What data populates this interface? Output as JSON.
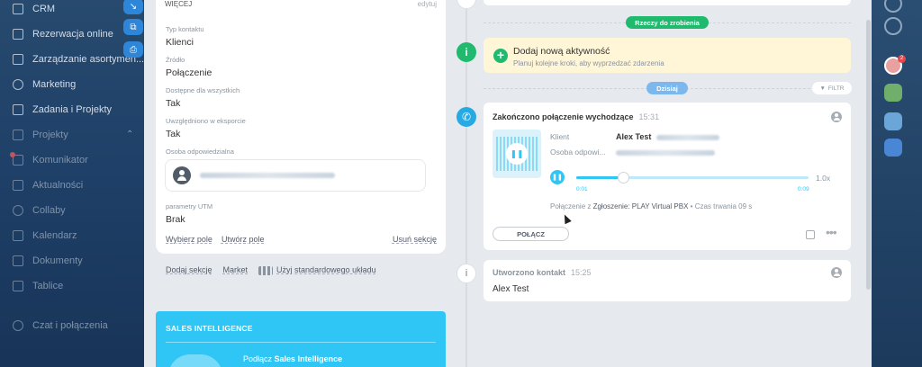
{
  "sidebar": {
    "items": [
      {
        "label": "CRM",
        "dim": false
      },
      {
        "label": "Rezerwacja online",
        "dim": false
      },
      {
        "label": "Zarządzanie asortymen...",
        "dim": false
      },
      {
        "label": "Marketing",
        "dim": false
      },
      {
        "label": "Zadania i Projekty",
        "dim": false
      },
      {
        "label": "Projekty",
        "dim": true
      },
      {
        "label": "Komunikator",
        "dim": true
      },
      {
        "label": "Aktualności",
        "dim": true
      },
      {
        "label": "Collaby",
        "dim": true
      },
      {
        "label": "Kalendarz",
        "dim": true
      },
      {
        "label": "Dokumenty",
        "dim": true
      },
      {
        "label": "Tablice",
        "dim": true
      },
      {
        "label": "Czat i połączenia",
        "dim": true
      }
    ]
  },
  "details": {
    "more_label": "WIĘCEJ",
    "edit_label": "edytuj",
    "contact_type_label": "Typ kontaktu",
    "contact_type_value": "Klienci",
    "source_label": "Źródło",
    "source_value": "Połączenie",
    "available_label": "Dostępne dla wszystkich",
    "available_value": "Tak",
    "export_label": "Uwzględniono w eksporcie",
    "export_value": "Tak",
    "responsible_label": "Osoba odpowiedzialna",
    "utm_label": "parametry UTM",
    "utm_value": "Brak",
    "select_field": "Wybierz pole",
    "create_field": "Utwórz pole",
    "delete_section": "Usuń sekcję"
  },
  "bottom_links": {
    "add_section": "Dodaj sekcję",
    "market": "Market",
    "default_layout": "Użyj standardowego układu"
  },
  "sales_intelligence": {
    "title": "SALES INTELLIGENCE",
    "connect_prefix": "Podłącz",
    "connect_name": "Sales Intelligence"
  },
  "timeline": {
    "todo_pill": "Rzeczy do zrobienia",
    "today_pill": "Dzisiaj",
    "filter": "FILTR",
    "todo_title": "Dodaj nową aktywność",
    "todo_sub": "Planuj kolejne kroki, aby wyprzedzać zdarzenia",
    "call": {
      "title": "Zakończono połączenie wychodzące",
      "time": "15:31",
      "client_label": "Klient",
      "client_value": "Alex Test",
      "person_label": "Osoba odpowi...",
      "speed": "1.0x",
      "time_start": "0:01",
      "time_end": "0:09",
      "progress": 0.2,
      "connection_prefix": "Połączenie z",
      "connection_source": "Zgłoszenie: PLAY Virtual PBX",
      "duration": "• Czas trwania 09 s",
      "connect_button": "POŁĄCZ"
    },
    "created": {
      "title": "Utworzono kontakt",
      "time": "15:25",
      "name": "Alex Test"
    }
  },
  "rail": {
    "badge": "2"
  },
  "colors": {
    "accent_blue": "#2fc6f6",
    "green": "#1fba6e",
    "todo_bg": "#fff5d7"
  }
}
